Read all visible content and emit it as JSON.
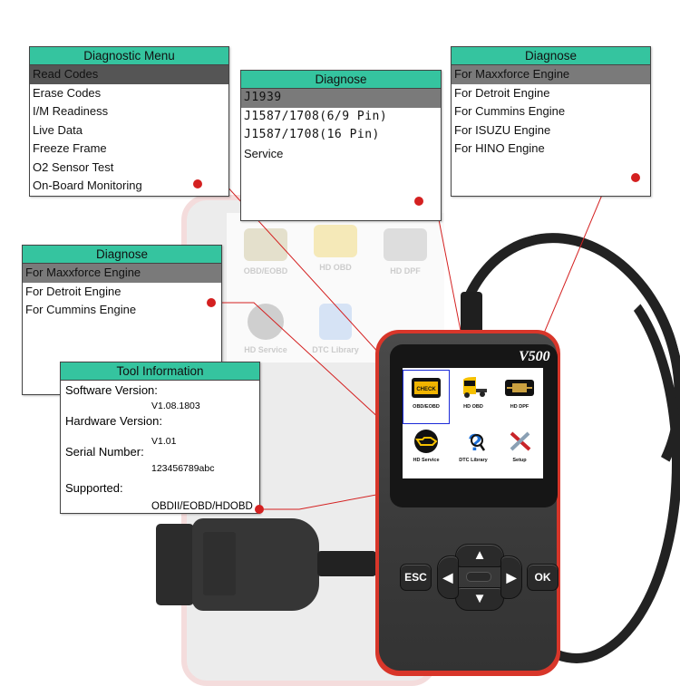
{
  "panels": {
    "diagnostic_menu": {
      "title": "Diagnostic Menu",
      "items": [
        "Read Codes",
        "Erase Codes",
        "I/M Readiness",
        "Live Data",
        "Freeze Frame",
        "O2 Sensor Test",
        "On-Board Monitoring"
      ],
      "selected_index": 0
    },
    "diagnose_protocol": {
      "title": "Diagnose",
      "items": [
        "J1939",
        "J1587/1708(6/9 Pin)",
        "J1587/1708(16 Pin)",
        "Service"
      ],
      "selected_index": 0
    },
    "diagnose_engine_full": {
      "title": "Diagnose",
      "items": [
        "For Maxxforce Engine",
        "For Detroit Engine",
        "For Cummins Engine",
        "For ISUZU Engine",
        "For HINO Engine"
      ],
      "selected_index": 0
    },
    "diagnose_engine_short": {
      "title": "Diagnose",
      "items": [
        "For Maxxforce Engine",
        "For Detroit Engine",
        "For Cummins Engine"
      ],
      "selected_index": 0
    },
    "tool_information": {
      "title": "Tool Information",
      "fields": [
        {
          "label": "Software Version:",
          "value": "V1.08.1803"
        },
        {
          "label": "Hardware Version:",
          "value": "V1.01"
        },
        {
          "label": "Serial Number:",
          "value": "123456789abc"
        },
        {
          "label": "Supported:",
          "value": "OBDII/EOBD/HDOBD"
        }
      ]
    }
  },
  "device": {
    "model": "V500",
    "menu_tiles": [
      {
        "label": "OBD/EOBD",
        "icon": "check-engine-icon",
        "active": true
      },
      {
        "label": "HD OBD",
        "icon": "truck-icon",
        "active": false
      },
      {
        "label": "HD DPF",
        "icon": "dpf-filter-icon",
        "active": false
      },
      {
        "label": "HD Service",
        "icon": "oil-can-icon",
        "active": false
      },
      {
        "label": "DTC Library",
        "icon": "question-magnifier-icon",
        "active": false
      },
      {
        "label": "Setup",
        "icon": "tools-icon",
        "active": false
      }
    ],
    "check_text": "CHECK",
    "keys": {
      "esc": "ESC",
      "ok": "OK",
      "up": "▲",
      "down": "▼",
      "left": "◀",
      "right": "▶"
    }
  },
  "background_device": {
    "tiles": [
      "OBD/EOBD",
      "HD OBD",
      "HD DPF",
      "HD Service",
      "DTC Library"
    ]
  },
  "colors": {
    "header_green": "#35c49f",
    "selected_gray": "#7a7a7a",
    "callout_red": "#d42020",
    "device_red": "#d8362a",
    "device_body": "#3f3f3f",
    "active_tile_blue": "#1a2ad8"
  }
}
